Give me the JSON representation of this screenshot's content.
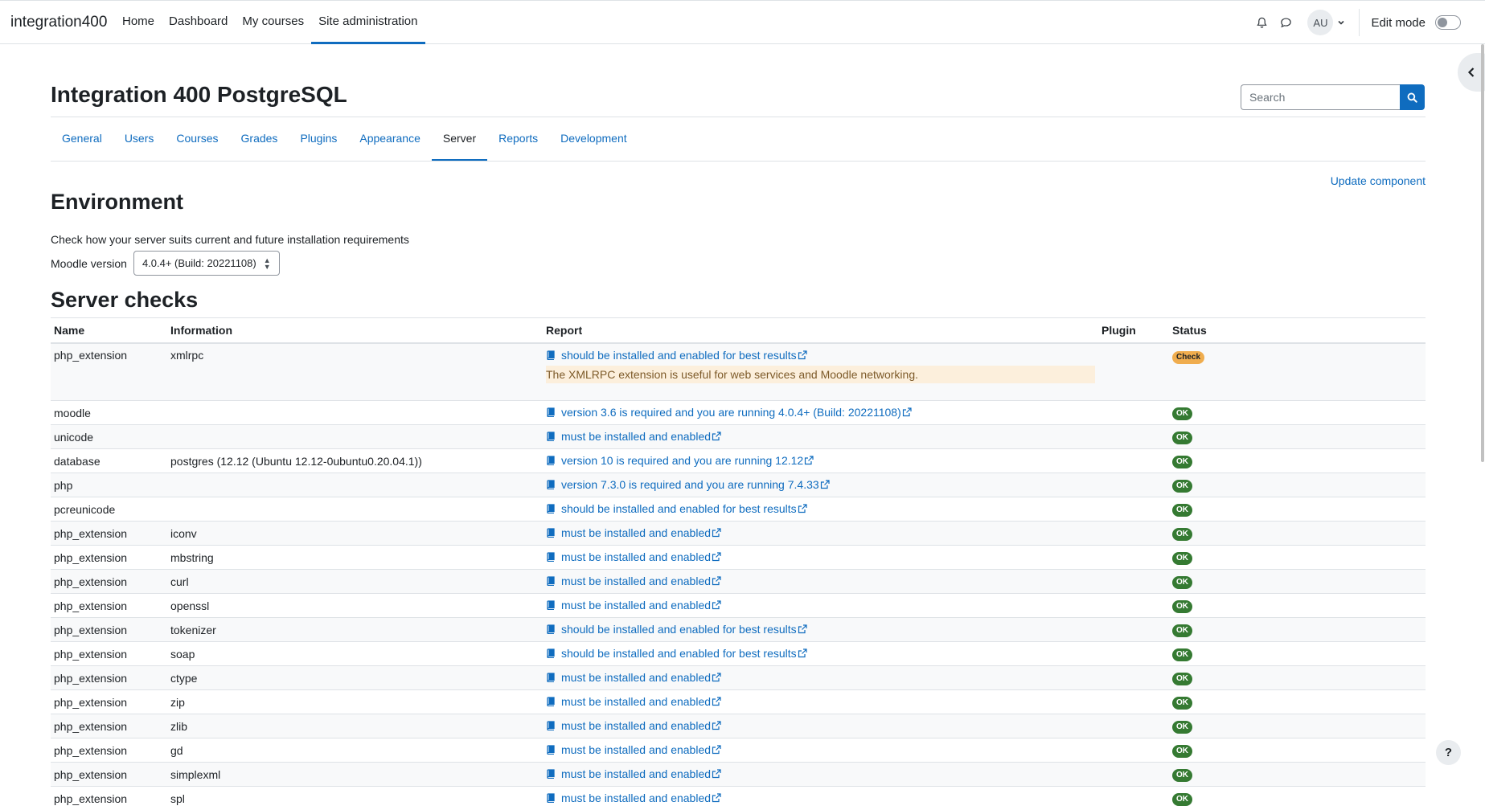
{
  "site": {
    "brand": "integration400"
  },
  "primary_nav": [
    {
      "label": "Home"
    },
    {
      "label": "Dashboard"
    },
    {
      "label": "My courses"
    },
    {
      "label": "Site administration",
      "active": true
    }
  ],
  "user": {
    "initials": "AU",
    "edit_mode_label": "Edit mode",
    "edit_mode_on": false
  },
  "page": {
    "title": "Integration 400 PostgreSQL"
  },
  "search": {
    "placeholder": "Search"
  },
  "tabs": [
    {
      "label": "General"
    },
    {
      "label": "Users"
    },
    {
      "label": "Courses"
    },
    {
      "label": "Grades"
    },
    {
      "label": "Plugins"
    },
    {
      "label": "Appearance"
    },
    {
      "label": "Server",
      "active": true
    },
    {
      "label": "Reports"
    },
    {
      "label": "Development"
    }
  ],
  "update_link": "Update component",
  "environment": {
    "heading": "Environment",
    "description": "Check how your server suits current and future installation requirements",
    "version_label": "Moodle version",
    "version_value": "4.0.4+ (Build: 20221108)"
  },
  "server_checks": {
    "heading": "Server checks",
    "columns": {
      "name": "Name",
      "information": "Information",
      "report": "Report",
      "plugin": "Plugin",
      "status": "Status"
    },
    "rows": [
      {
        "name": "php_extension",
        "info": "xmlrpc",
        "report": "should be installed and enabled for best results",
        "note": "The XMLRPC extension is useful for web services and Moodle networking.",
        "plugin": "",
        "status": "Check"
      },
      {
        "name": "moodle",
        "info": "",
        "report": "version 3.6 is required and you are running 4.0.4+ (Build: 20221108)",
        "plugin": "",
        "status": "OK"
      },
      {
        "name": "unicode",
        "info": "",
        "report": "must be installed and enabled",
        "plugin": "",
        "status": "OK"
      },
      {
        "name": "database",
        "info": "postgres (12.12 (Ubuntu 12.12-0ubuntu0.20.04.1))",
        "report": "version 10 is required and you are running 12.12",
        "plugin": "",
        "status": "OK"
      },
      {
        "name": "php",
        "info": "",
        "report": "version 7.3.0 is required and you are running 7.4.33",
        "plugin": "",
        "status": "OK"
      },
      {
        "name": "pcreunicode",
        "info": "",
        "report": "should be installed and enabled for best results",
        "plugin": "",
        "status": "OK"
      },
      {
        "name": "php_extension",
        "info": "iconv",
        "report": "must be installed and enabled",
        "plugin": "",
        "status": "OK"
      },
      {
        "name": "php_extension",
        "info": "mbstring",
        "report": "must be installed and enabled",
        "plugin": "",
        "status": "OK"
      },
      {
        "name": "php_extension",
        "info": "curl",
        "report": "must be installed and enabled",
        "plugin": "",
        "status": "OK"
      },
      {
        "name": "php_extension",
        "info": "openssl",
        "report": "must be installed and enabled",
        "plugin": "",
        "status": "OK"
      },
      {
        "name": "php_extension",
        "info": "tokenizer",
        "report": "should be installed and enabled for best results",
        "plugin": "",
        "status": "OK"
      },
      {
        "name": "php_extension",
        "info": "soap",
        "report": "should be installed and enabled for best results",
        "plugin": "",
        "status": "OK"
      },
      {
        "name": "php_extension",
        "info": "ctype",
        "report": "must be installed and enabled",
        "plugin": "",
        "status": "OK"
      },
      {
        "name": "php_extension",
        "info": "zip",
        "report": "must be installed and enabled",
        "plugin": "",
        "status": "OK"
      },
      {
        "name": "php_extension",
        "info": "zlib",
        "report": "must be installed and enabled",
        "plugin": "",
        "status": "OK"
      },
      {
        "name": "php_extension",
        "info": "gd",
        "report": "must be installed and enabled",
        "plugin": "",
        "status": "OK"
      },
      {
        "name": "php_extension",
        "info": "simplexml",
        "report": "must be installed and enabled",
        "plugin": "",
        "status": "OK"
      },
      {
        "name": "php_extension",
        "info": "spl",
        "report": "must be installed and enabled",
        "plugin": "",
        "status": "OK"
      }
    ]
  },
  "help": {
    "label": "?"
  },
  "colors": {
    "link": "#0f6cbf",
    "ok": "#357a32",
    "check": "#f0ad4e",
    "warn_bg": "#fcefdc"
  }
}
